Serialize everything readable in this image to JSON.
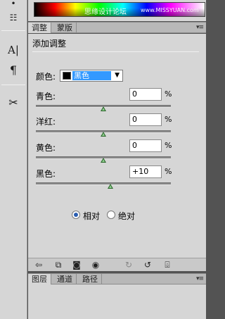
{
  "colors": {
    "accent": "#3399ff",
    "panel_bg": "#d6d6d6",
    "workspace": "#535353",
    "slider_thumb": "#2f6b2f"
  },
  "toolstrip": {
    "tools": [
      {
        "name": "brush-tool-icon",
        "glyph": "•"
      },
      {
        "name": "clone-source-icon",
        "glyph": "☷"
      },
      {
        "name": "character-icon",
        "glyph": "A|"
      },
      {
        "name": "paragraph-icon",
        "glyph": "¶"
      },
      {
        "name": "tools-preset-icon",
        "glyph": "✂"
      }
    ]
  },
  "watermark": {
    "cn": "思缘设计论坛",
    "url": "www.MISSYUAN.com"
  },
  "top_tabs": {
    "tab1": "调整",
    "tab2": "蒙版",
    "menu_glyph": "▾≡"
  },
  "adjustment": {
    "title": "添加调整",
    "color_label": "颜色:",
    "color_value": "黑色",
    "dropdown_arrow": "▼",
    "sliders": [
      {
        "label": "青色:",
        "value": "0",
        "unit": "%",
        "position": 0.5
      },
      {
        "label": "洋红:",
        "value": "0",
        "unit": "%",
        "position": 0.5
      },
      {
        "label": "黄色:",
        "value": "0",
        "unit": "%",
        "position": 0.5
      },
      {
        "label": "黑色:",
        "value": "+10",
        "unit": "%",
        "position": 0.55
      }
    ],
    "method": {
      "relative": "相对",
      "absolute": "绝对",
      "selected": "relative"
    }
  },
  "toolbar_icons": [
    {
      "name": "back-arrow-icon",
      "glyph": "⇦"
    },
    {
      "name": "expand-view-icon",
      "glyph": "⧉"
    },
    {
      "name": "clip-to-layer-icon",
      "glyph": "◙"
    },
    {
      "name": "visibility-eye-icon",
      "glyph": "◉"
    },
    {
      "name": "previous-state-icon",
      "glyph": "↻"
    },
    {
      "name": "reset-icon",
      "glyph": "↺"
    },
    {
      "name": "trash-icon",
      "glyph": "⌹"
    }
  ],
  "bottom_tabs": {
    "tab1": "图层",
    "tab2": "通道",
    "tab3": "路径",
    "menu_glyph": "▾≡"
  }
}
